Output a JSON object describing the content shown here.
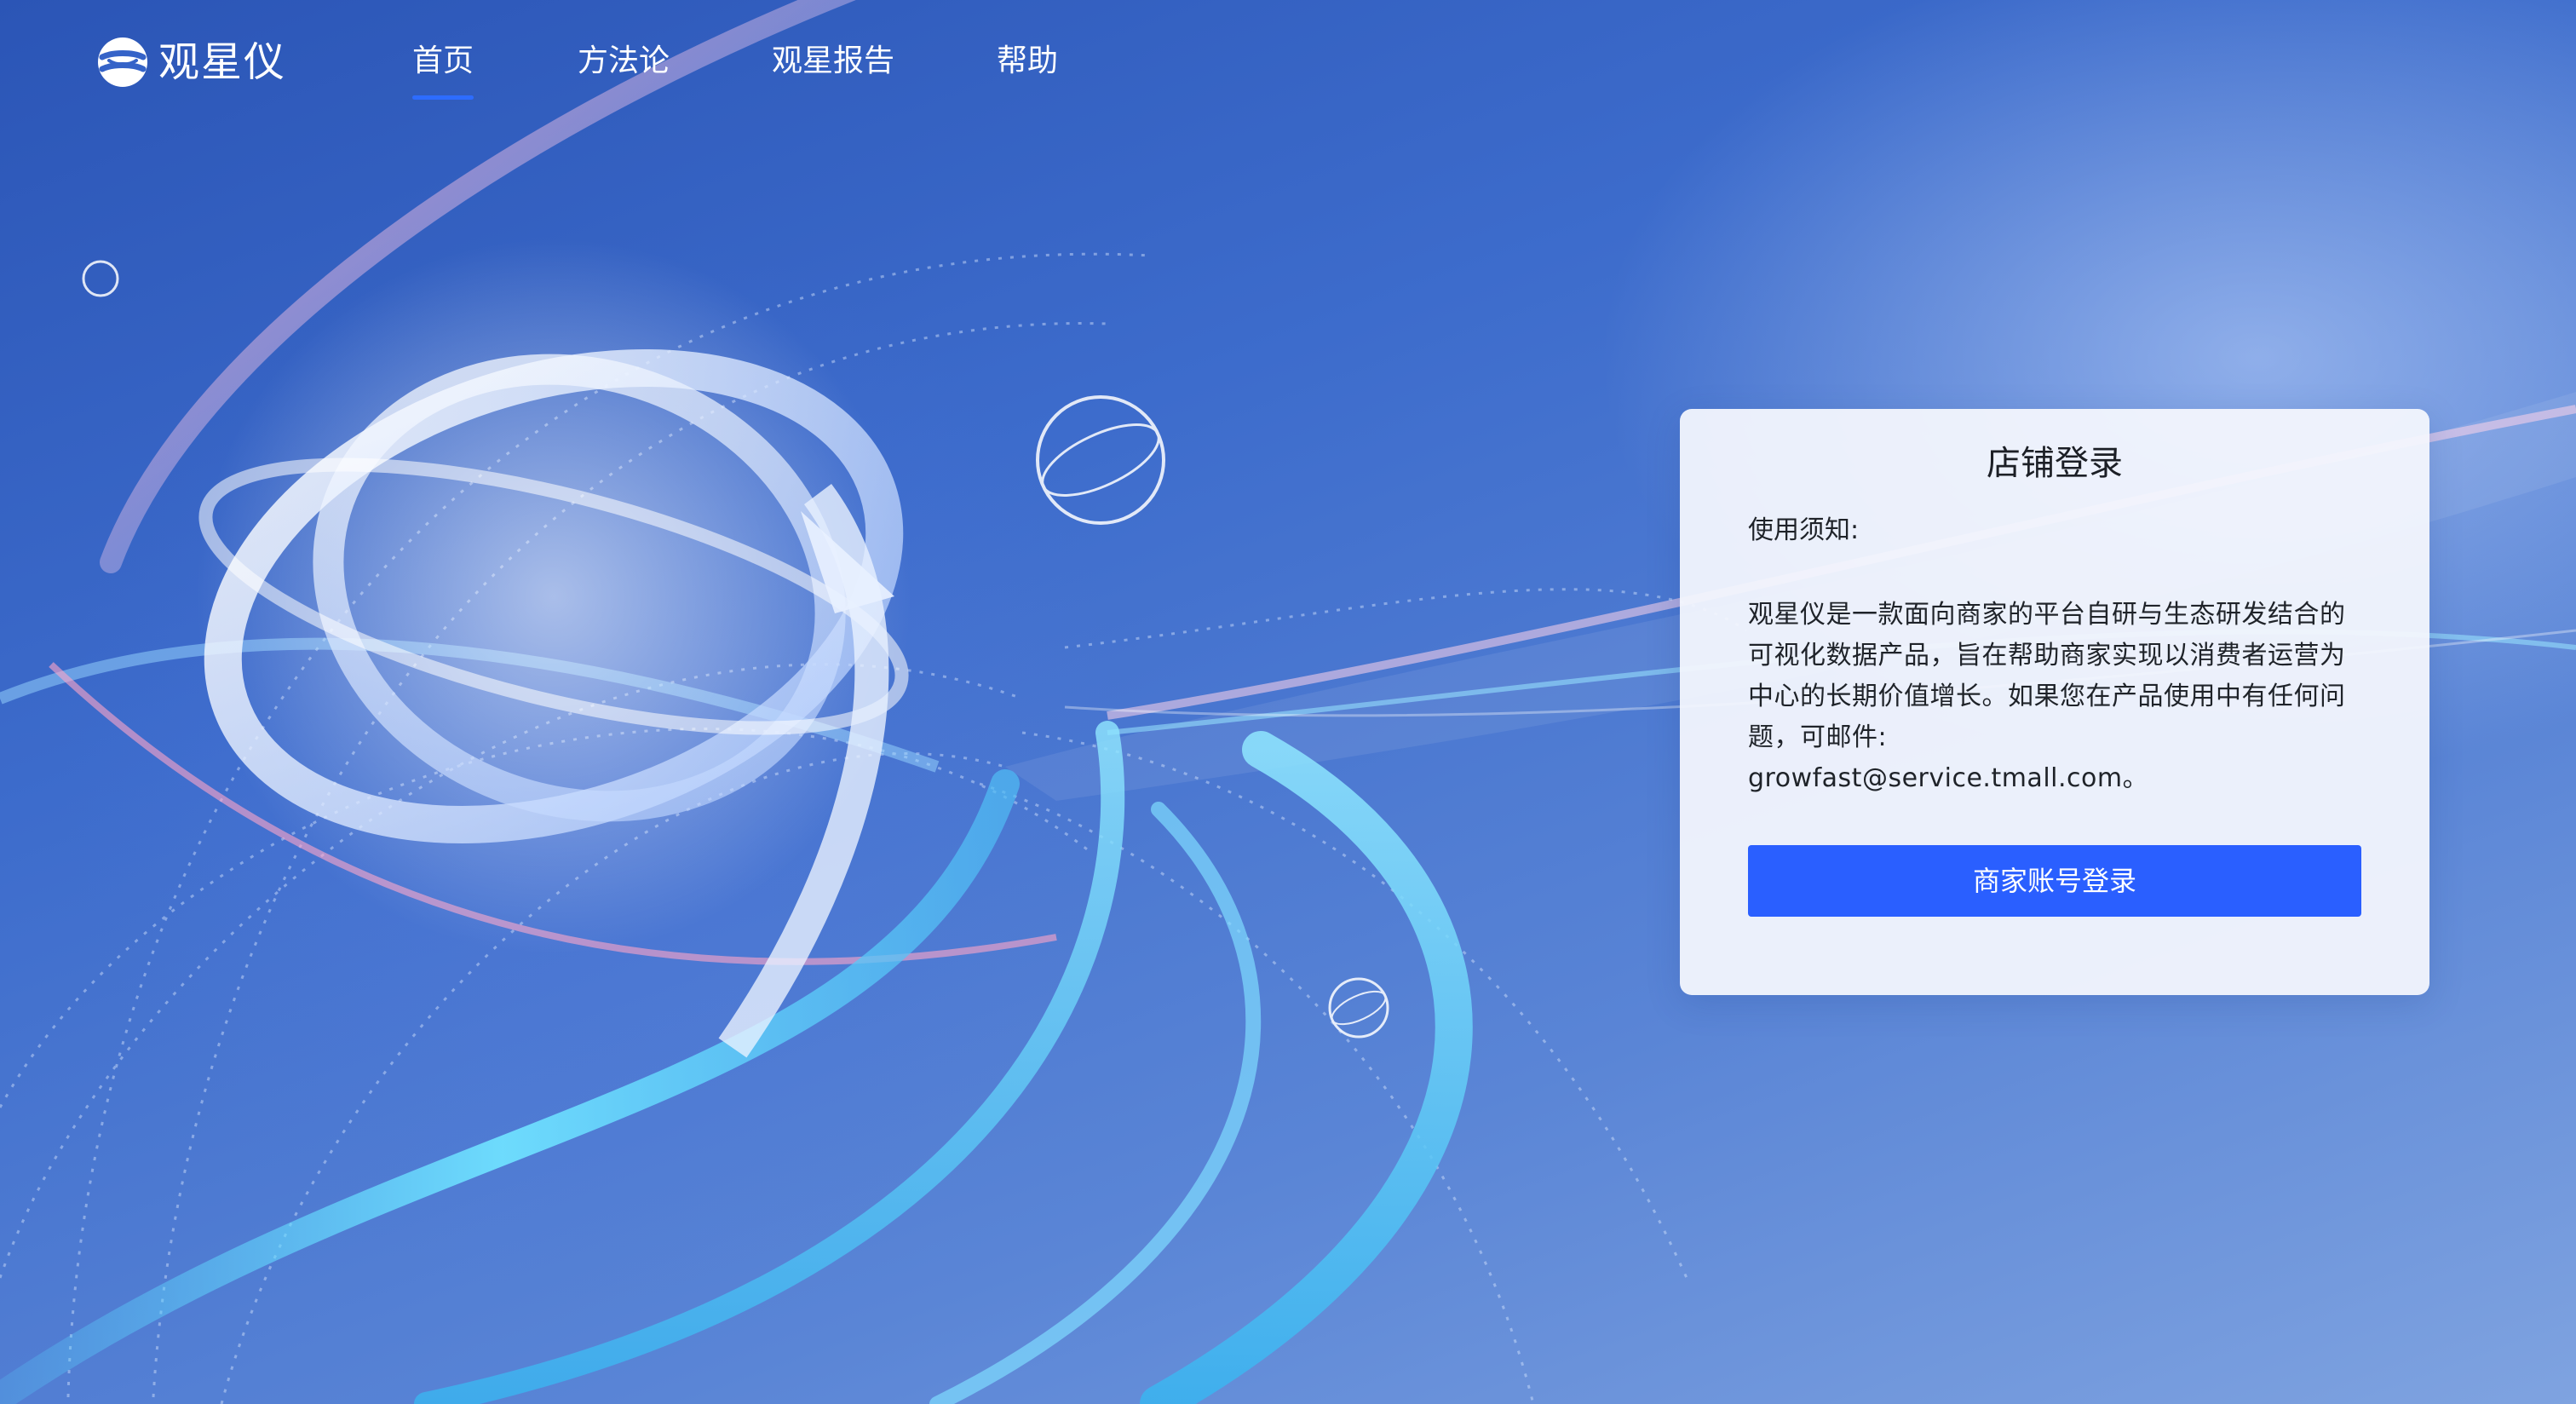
{
  "brand": {
    "name": "观星仪",
    "icon": "globe-logo-icon"
  },
  "nav": {
    "items": [
      {
        "label": "首页",
        "active": true
      },
      {
        "label": "方法论",
        "active": false
      },
      {
        "label": "观星报告",
        "active": false
      },
      {
        "label": "帮助",
        "active": false
      }
    ]
  },
  "login": {
    "title": "店铺登录",
    "notice_label": "使用须知:",
    "description": "观星仪是一款面向商家的平台自研与生态研发结合的可视化数据产品，旨在帮助商家实现以消费者运营为中心的长期价值增长。如果您在产品使用中有任何问题，可邮件:",
    "email": "growfast@service.tmall.com。",
    "button_label": "商家账号登录"
  },
  "colors": {
    "primary": "#2a5fff",
    "nav_active_underline": "#2d6cff",
    "background_deep": "#2b55b6",
    "background_light": "#7fa3e0",
    "card_background": "#f4f7fd"
  }
}
